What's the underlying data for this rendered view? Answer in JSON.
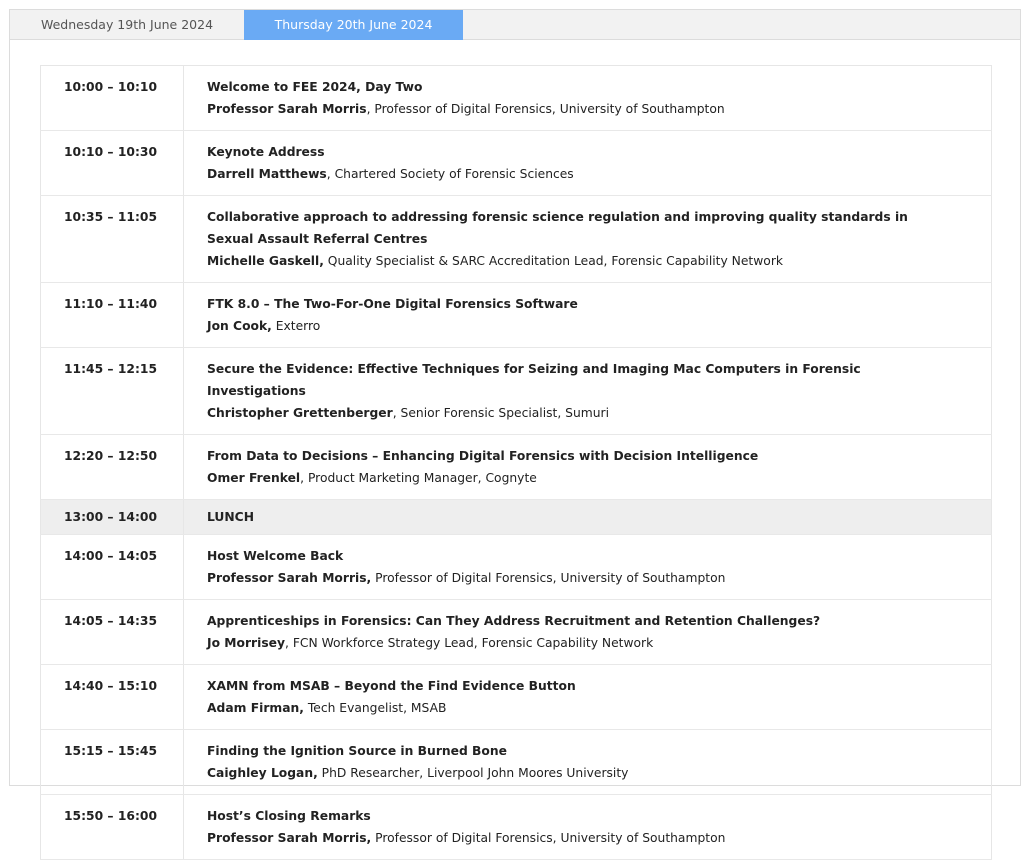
{
  "tabs": [
    {
      "label": "Wednesday 19th June 2024",
      "active": false
    },
    {
      "label": "Thursday 20th June 2024",
      "active": true
    }
  ],
  "colors": {
    "active_tab": "#6aaaf4",
    "lunch_row": "#eeeeee"
  },
  "sessions": [
    {
      "time": "10:00 – 10:10",
      "title": "Welcome to FEE 2024, Day Two",
      "speaker": "Professor Sarah Morris",
      "affiliation": ", Professor of Digital Forensics, University of Southampton"
    },
    {
      "time": "10:10 – 10:30",
      "title": "Keynote Address",
      "speaker": "Darrell Matthews",
      "affiliation": ", Chartered Society of Forensic Sciences"
    },
    {
      "time": "10:35 – 11:05",
      "title": "Collaborative approach to addressing forensic science regulation and improving quality standards in Sexual Assault Referral Centres",
      "speaker": "Michelle Gaskell,",
      "affiliation": " Quality Specialist & SARC Accreditation Lead, Forensic Capability Network"
    },
    {
      "time": "11:10 – 11:40",
      "title": "FTK 8.0 – The Two-For-One Digital Forensics Software",
      "speaker": "Jon Cook,",
      "affiliation": " Exterro"
    },
    {
      "time": "11:45 – 12:15",
      "title": "Secure the Evidence: Effective Techniques for Seizing and Imaging Mac Computers in Forensic Investigations",
      "speaker": "Christopher Grettenberger",
      "affiliation": ", Senior Forensic Specialist, Sumuri"
    },
    {
      "time": "12:20 – 12:50",
      "title": "From Data to Decisions – Enhancing Digital Forensics with Decision Intelligence",
      "speaker": "Omer Frenkel",
      "affiliation": ", Product Marketing Manager, Cognyte"
    },
    {
      "time": "13:00 – 14:00",
      "title": "LUNCH",
      "speaker": "",
      "affiliation": "",
      "lunch": true
    },
    {
      "time": "14:00 – 14:05",
      "title": "Host Welcome Back",
      "speaker": "Professor Sarah Morris,",
      "affiliation": " Professor of Digital Forensics, University of Southampton"
    },
    {
      "time": "14:05 – 14:35",
      "title": "Apprenticeships in Forensics: Can They Address Recruitment and Retention Challenges?",
      "speaker": "Jo Morrisey",
      "affiliation": ", FCN Workforce Strategy Lead, Forensic Capability Network"
    },
    {
      "time": "14:40 – 15:10",
      "title": "XAMN from MSAB – Beyond the Find Evidence Button",
      "speaker": "Adam Firman,",
      "affiliation": " Tech Evangelist, MSAB"
    },
    {
      "time": "15:15 – 15:45",
      "title": "Finding the Ignition Source in Burned Bone",
      "speaker": "Caighley Logan,",
      "affiliation": " PhD Researcher, Liverpool John Moores University"
    },
    {
      "time": "15:50 – 16:00",
      "title": "Host’s Closing Remarks",
      "speaker": "Professor Sarah Morris,",
      "affiliation": " Professor of Digital Forensics, University of Southampton"
    }
  ]
}
